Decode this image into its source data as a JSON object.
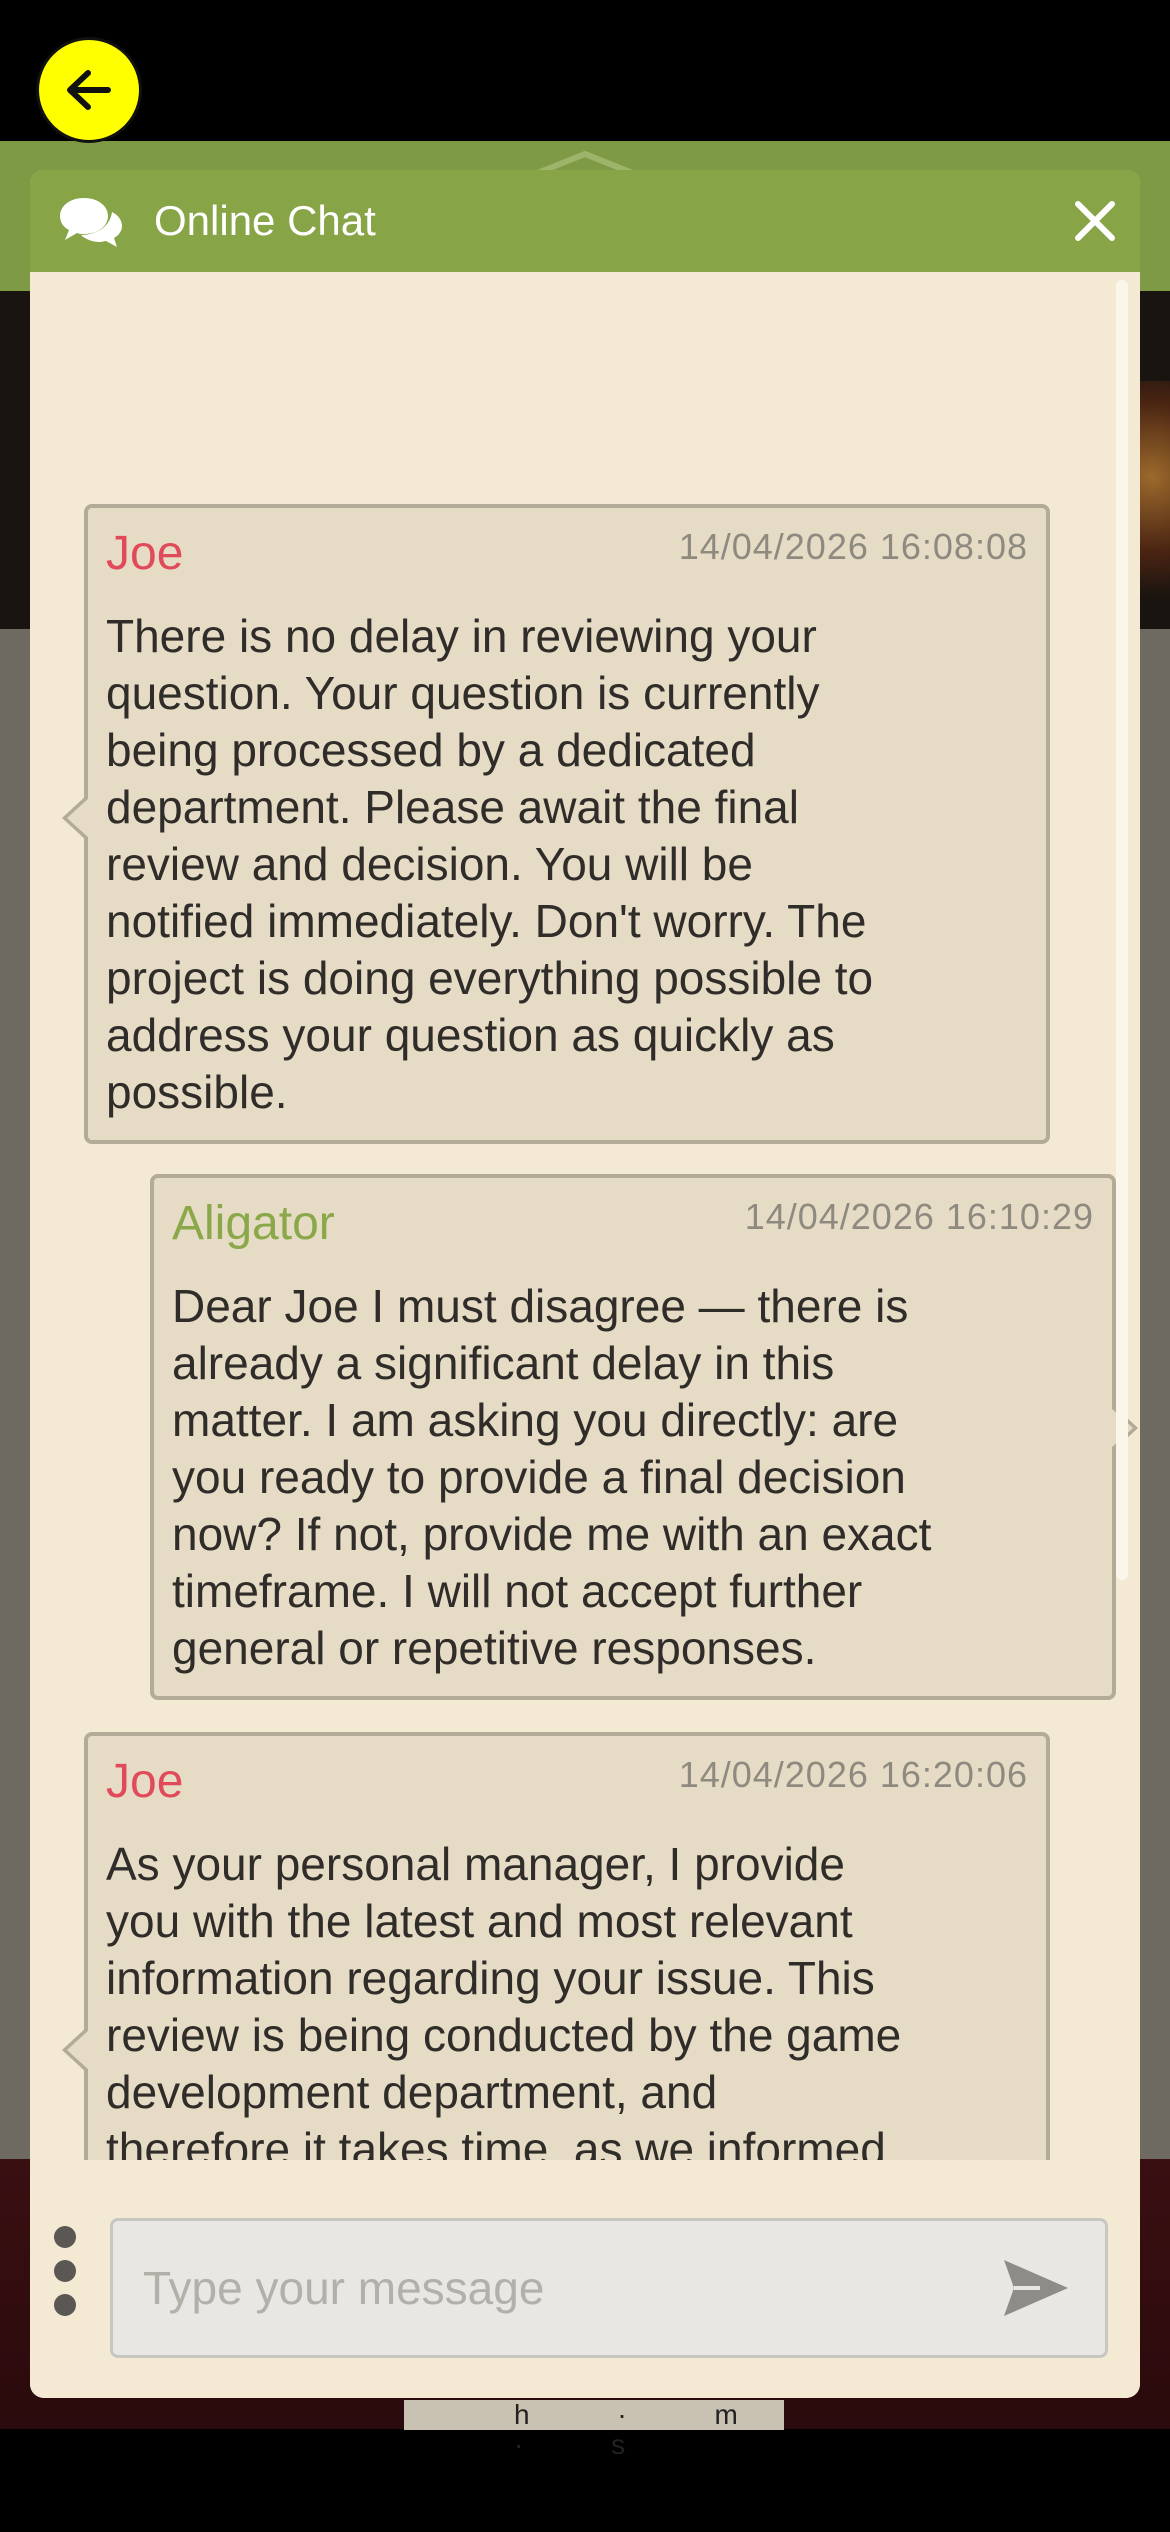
{
  "chat": {
    "title": "Online Chat",
    "messages": [
      {
        "author": "Joe",
        "timestamp": "14/04/2026 16:08:08",
        "text": "There is no delay in reviewing your\nquestion. Your question is currently\nbeing processed by a dedicated\ndepartment. Please await the final\nreview and decision. You will be\nnotified immediately. Don't worry. The\nproject is doing everything possible to\naddress your question as quickly as\npossible."
      },
      {
        "author": "Aligator",
        "timestamp": "14/04/2026 16:10:29",
        "text": "Dear Joe I must disagree — there is\nalready a significant delay in this\nmatter. I am asking you directly: are\nyou ready to provide a final decision\nnow? If not, provide me with an exact\ntimeframe. I will not accept further\ngeneral or repetitive responses."
      },
      {
        "author": "Joe",
        "timestamp": "14/04/2026 16:20:06",
        "text": "As your personal manager, I provide\nyou with the latest and most relevant\ninformation regarding your issue. This\nreview is being conducted by the game\ndevelopment department, and\ntherefore it takes time, as we informed\nyou earlier.\nAs soon as news or additional\ninformation is available, I or the project"
      }
    ],
    "input": {
      "placeholder": "Type your message",
      "value": ""
    }
  },
  "background": {
    "bottom_strip_text": "h · m · s"
  },
  "colors": {
    "header_green": "#87a446",
    "panel_bg": "#f4ead4",
    "bubble_bg": "#e6dcc5",
    "agent_name": "#e04a5a",
    "user_name": "#8aa84a",
    "back_button": "#ffff00"
  },
  "icons": {
    "back": "arrow-left-icon",
    "chat": "chat-bubbles-icon",
    "close": "close-icon",
    "more": "vertical-dots-icon",
    "send": "send-icon"
  }
}
